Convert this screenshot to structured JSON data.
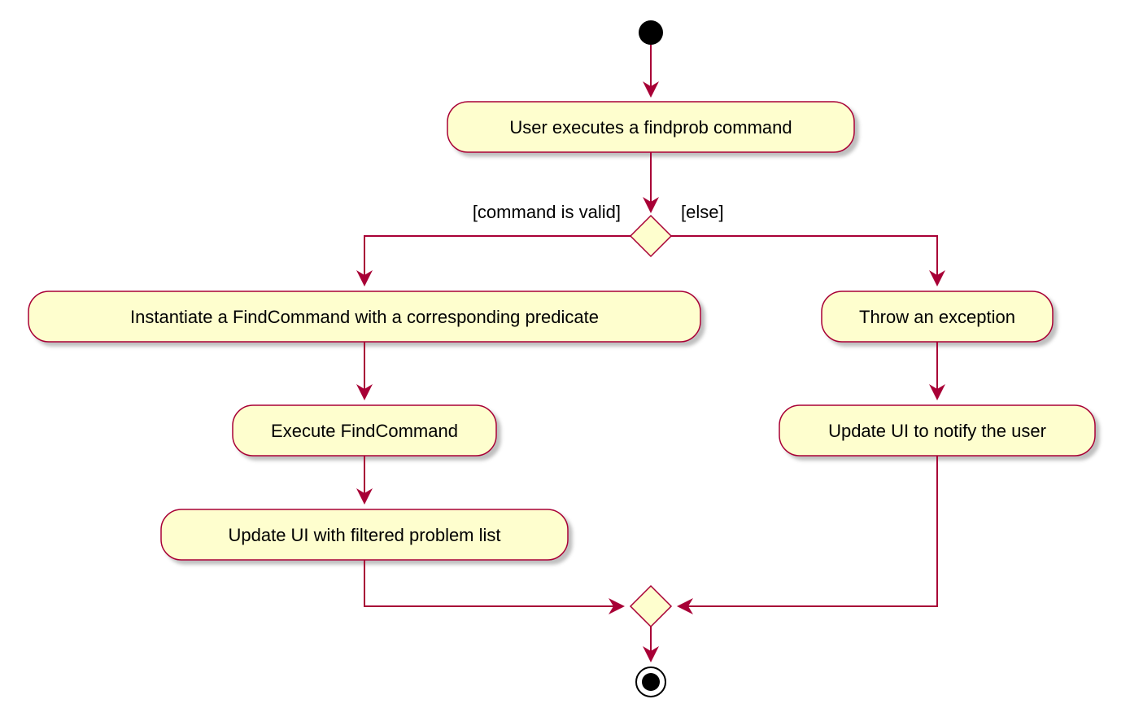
{
  "diagram": {
    "type": "uml-activity",
    "activities": {
      "start": "User executes a findprob command",
      "valid_1": "Instantiate a FindCommand with a corresponding predicate",
      "valid_2": "Execute FindCommand",
      "valid_3": "Update UI with filtered problem list",
      "else_1": "Throw an exception",
      "else_2": "Update UI to notify the user"
    },
    "guards": {
      "valid": "[command is valid]",
      "else": "[else]"
    }
  }
}
